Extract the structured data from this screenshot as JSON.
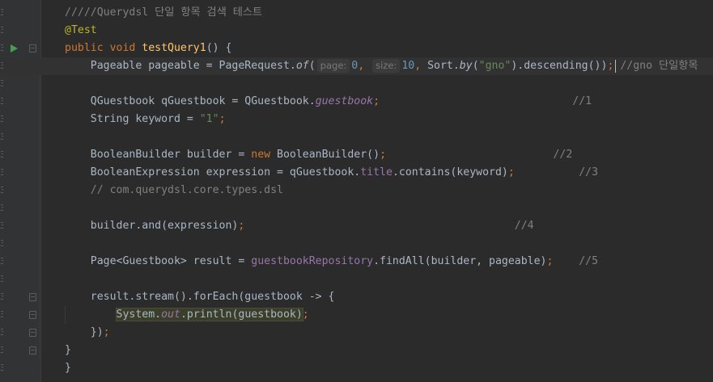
{
  "editor": {
    "lines": [
      {
        "num": "3",
        "segs": [
          [
            "cmt",
            "/////Querydsl 단일 항목 검색 테스트"
          ]
        ]
      },
      {
        "num": "3",
        "segs": [
          [
            "ann",
            "@Test"
          ]
        ]
      },
      {
        "num": "3",
        "segs": [
          [
            "kw",
            "public void "
          ],
          [
            "fn",
            "testQuery1"
          ],
          [
            "",
            "() {"
          ]
        ]
      },
      {
        "num": "3",
        "segs": [
          [
            "",
            "    Pageable pageable = PageRequest."
          ],
          [
            "static",
            "of"
          ],
          [
            "",
            "("
          ],
          [
            "hint",
            "page:"
          ],
          [
            "num",
            "0"
          ],
          [
            "kw",
            ", "
          ],
          [
            "hint",
            "size:"
          ],
          [
            "num",
            "10"
          ],
          [
            "kw",
            ", "
          ],
          [
            "",
            "Sort."
          ],
          [
            "static",
            "by"
          ],
          [
            "",
            "("
          ],
          [
            "str",
            "\"gno\""
          ],
          [
            "",
            ").descending())"
          ],
          [
            "kw",
            ";"
          ],
          [
            "cmt",
            " //gno 단일항목"
          ]
        ]
      },
      {
        "num": "3",
        "segs": []
      },
      {
        "num": "3",
        "segs": [
          [
            "",
            "    QGuestbook qGuestbook = QGuestbook."
          ],
          [
            "ifield",
            "guestbook"
          ],
          [
            "kw",
            ";"
          ],
          [
            "cmt",
            "                              //1"
          ]
        ]
      },
      {
        "num": "3",
        "segs": [
          [
            "",
            "    String keyword = "
          ],
          [
            "str",
            "\"1\""
          ],
          [
            "kw",
            ";"
          ]
        ]
      },
      {
        "num": "3",
        "segs": []
      },
      {
        "num": "3",
        "segs": [
          [
            "",
            "    BooleanBuilder builder = "
          ],
          [
            "kw",
            "new "
          ],
          [
            "",
            "BooleanBuilder()"
          ],
          [
            "kw",
            ";"
          ],
          [
            "cmt",
            "                          //2"
          ]
        ]
      },
      {
        "num": "3",
        "segs": [
          [
            "",
            "    BooleanExpression expression = qGuestbook."
          ],
          [
            "field",
            "title"
          ],
          [
            "",
            ".contains(keyword)"
          ],
          [
            "kw",
            ";"
          ],
          [
            "cmt",
            "          //3"
          ]
        ]
      },
      {
        "num": "3",
        "segs": [
          [
            "cmt",
            "    // com.querydsl.core.types.dsl"
          ]
        ]
      },
      {
        "num": "3",
        "segs": []
      },
      {
        "num": "3",
        "segs": [
          [
            "",
            "    builder.and(expression)"
          ],
          [
            "kw",
            ";"
          ],
          [
            "cmt",
            "                                          //4"
          ]
        ]
      },
      {
        "num": "3",
        "segs": []
      },
      {
        "num": "3",
        "segs": [
          [
            "",
            "    Page<Guestbook> result = "
          ],
          [
            "field",
            "guestbookRepository"
          ],
          [
            "",
            ".findAll(builder, pageable)"
          ],
          [
            "kw",
            ";"
          ],
          [
            "cmt",
            "    //5"
          ]
        ]
      },
      {
        "num": "3",
        "segs": []
      },
      {
        "num": "3",
        "segs": [
          [
            "",
            "    result.stream().forEach(guestbook -> {"
          ]
        ]
      },
      {
        "num": "3",
        "segs": [
          [
            "",
            "        "
          ],
          [
            "sel",
            "System."
          ],
          [
            "selfield",
            "out"
          ],
          [
            "sel",
            ".println(guestbook)"
          ],
          [
            "kw",
            ";"
          ]
        ]
      },
      {
        "num": "3",
        "segs": [
          [
            "",
            "    })"
          ],
          [
            "kw",
            ";"
          ]
        ]
      },
      {
        "num": "3",
        "segs": [
          [
            "",
            "}"
          ]
        ]
      },
      {
        "num": "3",
        "segs": [
          [
            "",
            "}"
          ]
        ]
      }
    ],
    "icons": {
      "run": "run-gutter-icon",
      "fold": "fold-marker-icon"
    },
    "colors": {
      "background": "#2b2b2b",
      "keyword": "#cc7832",
      "string": "#6a8759",
      "number": "#6897bb",
      "comment": "#808080",
      "function": "#ffc66d",
      "field": "#9876aa",
      "annotation": "#bbb529"
    }
  }
}
